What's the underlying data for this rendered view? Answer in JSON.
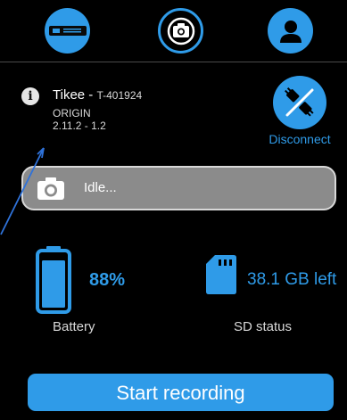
{
  "nav": {
    "items": [
      {
        "name": "device-tab",
        "icon": "device-icon"
      },
      {
        "name": "camera-tab",
        "icon": "camera-switch-icon"
      },
      {
        "name": "profile-tab",
        "icon": "user-icon"
      }
    ]
  },
  "device": {
    "name": "Tikee",
    "separator": " - ",
    "id": "T-401924",
    "origin": "ORIGIN",
    "version": "2.11.2 - 1.2"
  },
  "disconnect": {
    "label": "Disconnect",
    "icon": "plug-disconnect-icon"
  },
  "status": {
    "text": "Idle...",
    "icon": "camera-icon"
  },
  "battery": {
    "value": "88%",
    "label": "Battery",
    "level": 0.88,
    "icon": "battery-icon"
  },
  "sd": {
    "value": "38.1 GB left",
    "label": "SD status",
    "icon": "sd-card-icon"
  },
  "actions": {
    "start_label": "Start recording"
  },
  "colors": {
    "accent": "#2F9BE8",
    "background": "#000000",
    "status_bg": "#8B8B8B",
    "divider": "#4A4A4A"
  }
}
